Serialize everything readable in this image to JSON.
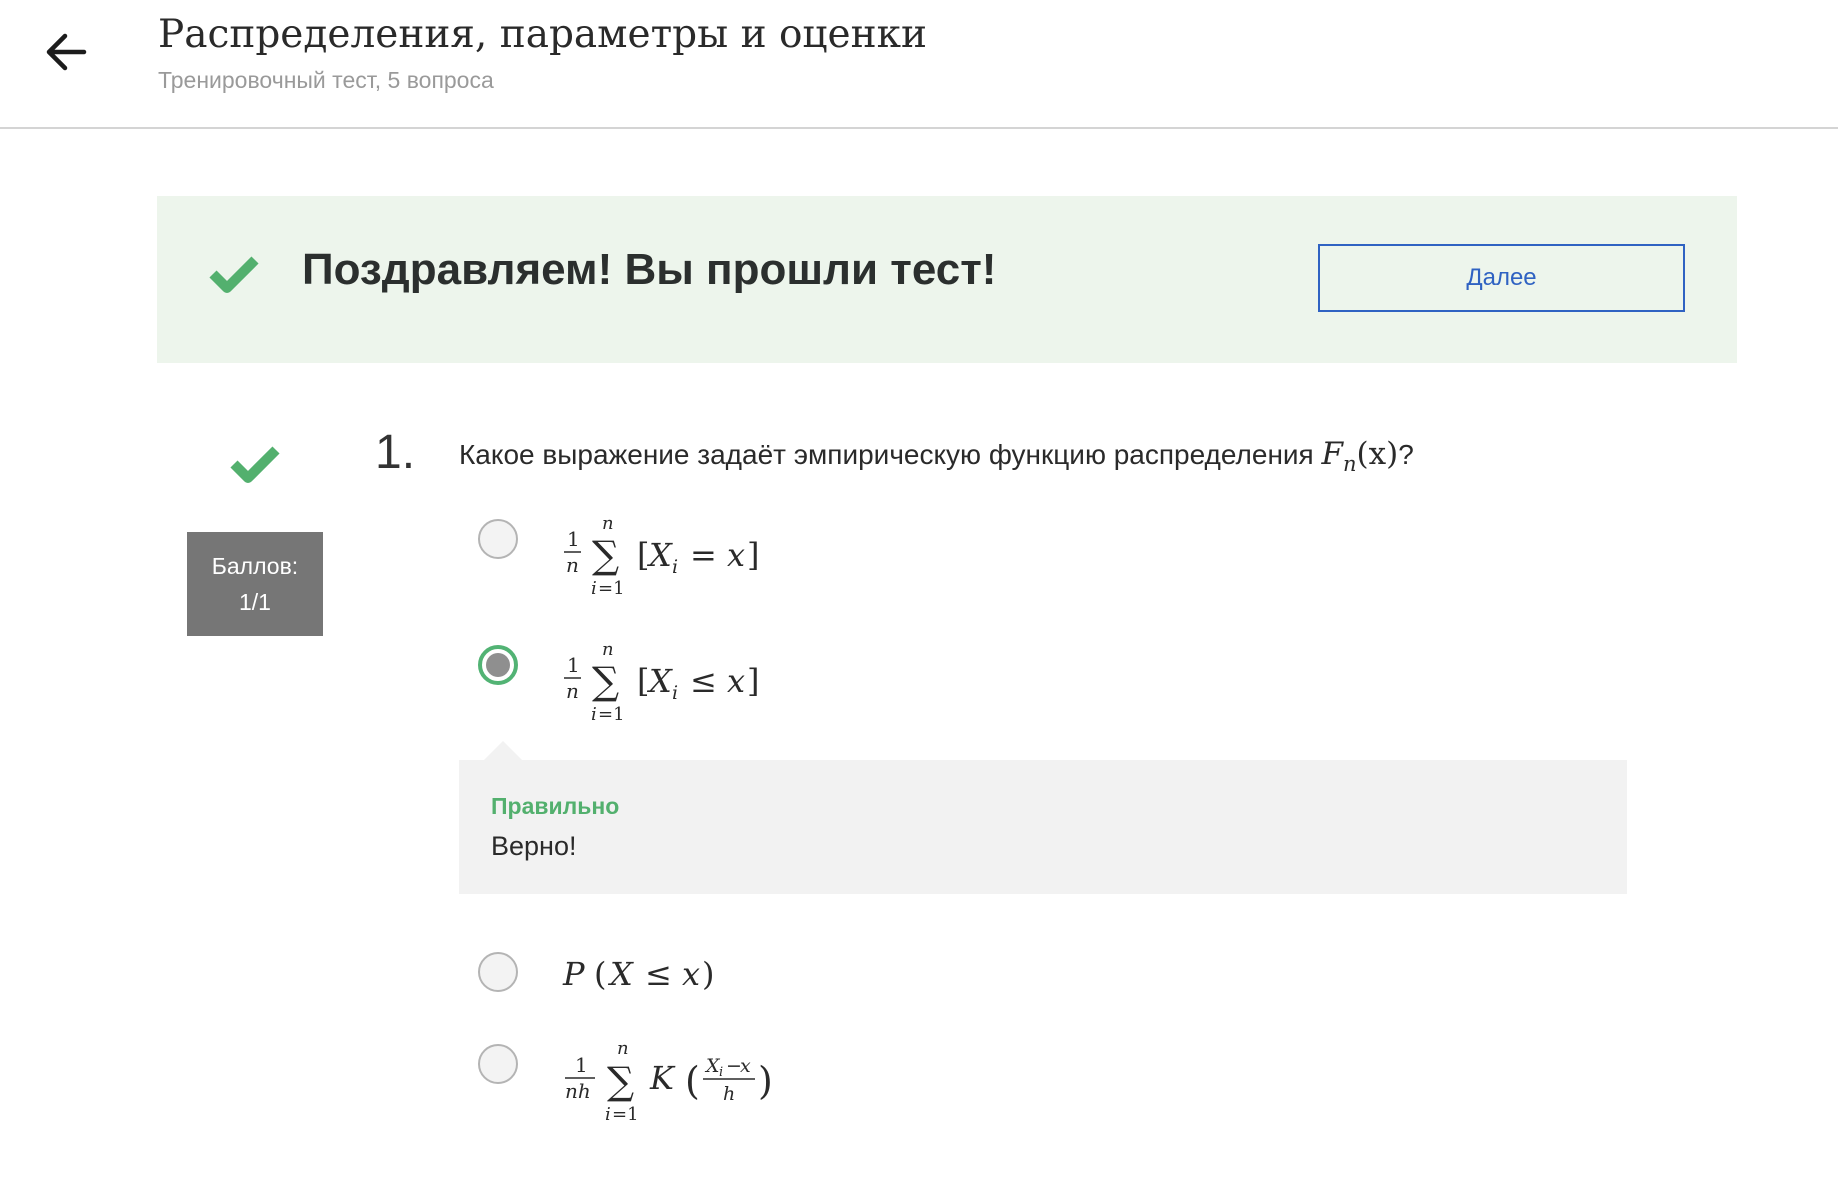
{
  "header": {
    "title": "Распределения, параметры и оценки",
    "subtitle": "Тренировочный тест, 5 вопроса",
    "back_icon": "arrow-left-icon"
  },
  "banner": {
    "icon": "checkmark-icon",
    "message": "Поздравляем! Вы прошли тест!",
    "next_label": "Далее"
  },
  "question": {
    "number": "1.",
    "text": "Какое выражение задаёт эмпирическую функцию распределения",
    "math_F": "F",
    "math_n": "n",
    "math_x": "(x)",
    "question_mark": "?",
    "status_icon": "checkmark-icon",
    "score_label": "Баллов:",
    "score_value": "1/1"
  },
  "options": [
    {
      "latex": "\\frac{1}{n}\\sum_{i=1}^{n}[X_i = x]",
      "selected": false
    },
    {
      "latex": "\\frac{1}{n}\\sum_{i=1}^{n}[X_i \\le x]",
      "selected": true
    },
    {
      "latex": "P(X \\le x)",
      "selected": false
    },
    {
      "latex": "\\frac{1}{nh}\\sum_{i=1}^{n}K\\left(\\frac{X_i - x}{h}\\right)",
      "selected": false
    }
  ],
  "feedback": {
    "title": "Правильно",
    "text": "Верно!"
  },
  "colors": {
    "accent_green": "#53b06e",
    "link_blue": "#2f62c2",
    "banner_bg": "#edf5ec",
    "badge_bg": "#767676"
  }
}
